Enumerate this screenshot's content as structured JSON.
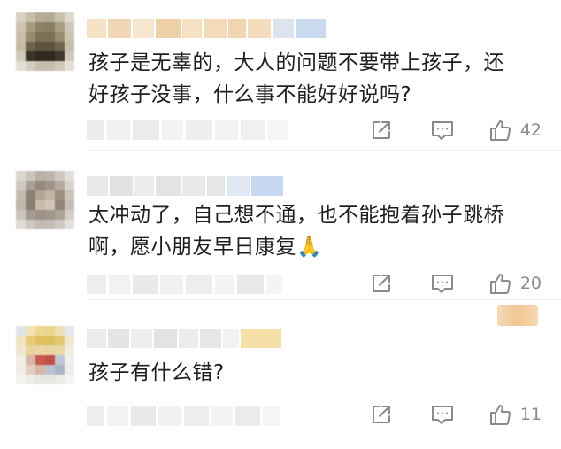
{
  "comments": [
    {
      "text_line1": "孩子是无辜的，大人的问题不要带上孩子，还",
      "text_line2": "好孩子没事，什么事不能好好说吗?",
      "likes": "42"
    },
    {
      "text_line1": "太冲动了，自己想不通，也不能抱着孙子跳桥",
      "text_line2": "啊，愿小朋友早日康复🙏",
      "likes": "20"
    },
    {
      "text_line1": "孩子有什么错?",
      "text_line2": "",
      "likes": "11"
    }
  ],
  "icons": {
    "share": "share-icon",
    "reply": "reply-icon",
    "like": "thumbs-up-icon"
  },
  "colors": {
    "muted": "#8a8a8a",
    "text": "#1e1e1e",
    "icon": "#8a8a8a"
  }
}
